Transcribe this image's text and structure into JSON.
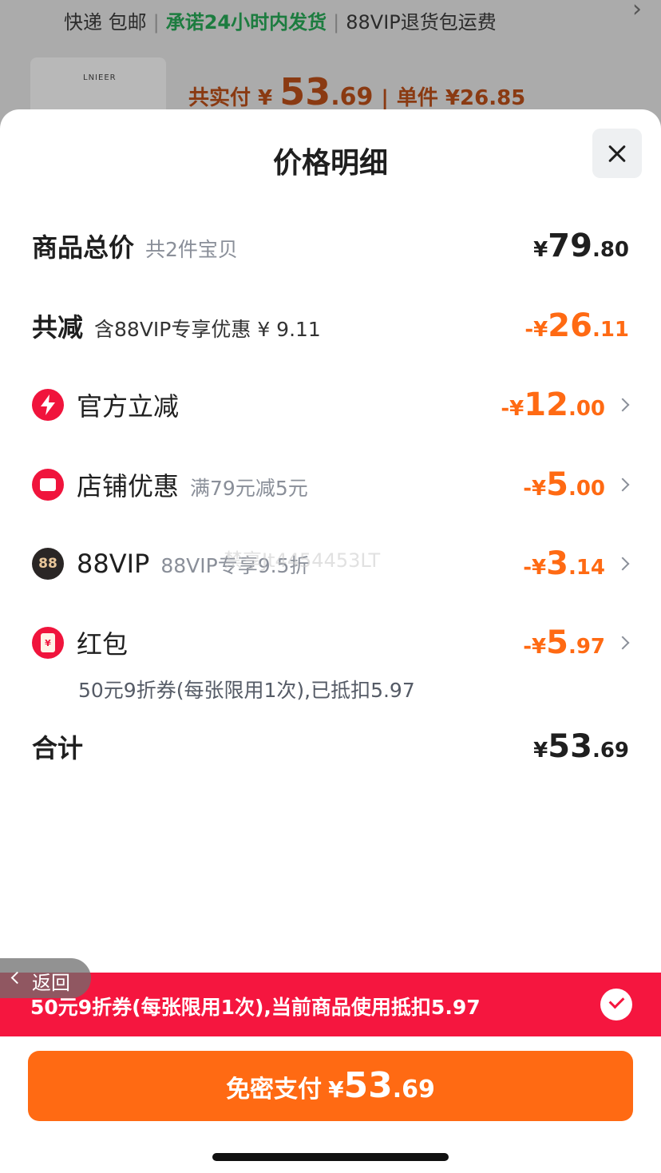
{
  "background": {
    "delivery": "快递 包邮",
    "promise": "承诺24小时内发货",
    "vip_return": "88VIP退货包运费",
    "thumb_brand": "LNIEER",
    "pay_label": "共实付 ¥ ",
    "pay_int": "53",
    "pay_dec": ".69",
    "unit_price": "单件 ¥26.85"
  },
  "sheet": {
    "title": "价格明细",
    "close_icon": "close-icon"
  },
  "rows": {
    "total": {
      "label": "商品总价",
      "sub": "共2件宝贝",
      "yen": "¥",
      "int": "79",
      "dec": ".80"
    },
    "reduce": {
      "label": "共减",
      "sub": "含88VIP专享优惠 ¥ 9.11",
      "yen": "-¥",
      "int": "26",
      "dec": ".11"
    },
    "official": {
      "label": "官方立减",
      "yen": "-¥",
      "int": "12",
      "dec": ".00"
    },
    "shop": {
      "label": "店铺优惠",
      "sub": "满79元减5元",
      "yen": "-¥",
      "int": "5",
      "dec": ".00"
    },
    "vip": {
      "icon_text": "88",
      "label": "88VIP",
      "sub": "88VIP专享9.5折",
      "yen": "-¥",
      "int": "3",
      "dec": ".14"
    },
    "redpacket": {
      "icon_text": "¥",
      "label": "红包",
      "yen": "-¥",
      "int": "5",
      "dec": ".97",
      "note": "50元9折券(每张限用1次),已抵扣5.97"
    },
    "sum": {
      "label": "合计",
      "yen": "¥",
      "int": "53",
      "dec": ".69"
    }
  },
  "watermark": "禁享Jt4454453LT",
  "banner": {
    "text": "50元9折券(每张限用1次),当前商品使用抵扣5.97"
  },
  "back": {
    "label": "返回"
  },
  "pay_button": {
    "label": "免密支付",
    "yen": "¥",
    "int": "53",
    "dec": ".69"
  },
  "colors": {
    "accent_orange": "#ff6a13",
    "banner_red": "#f5163f",
    "icon_red": "#f0143c"
  }
}
